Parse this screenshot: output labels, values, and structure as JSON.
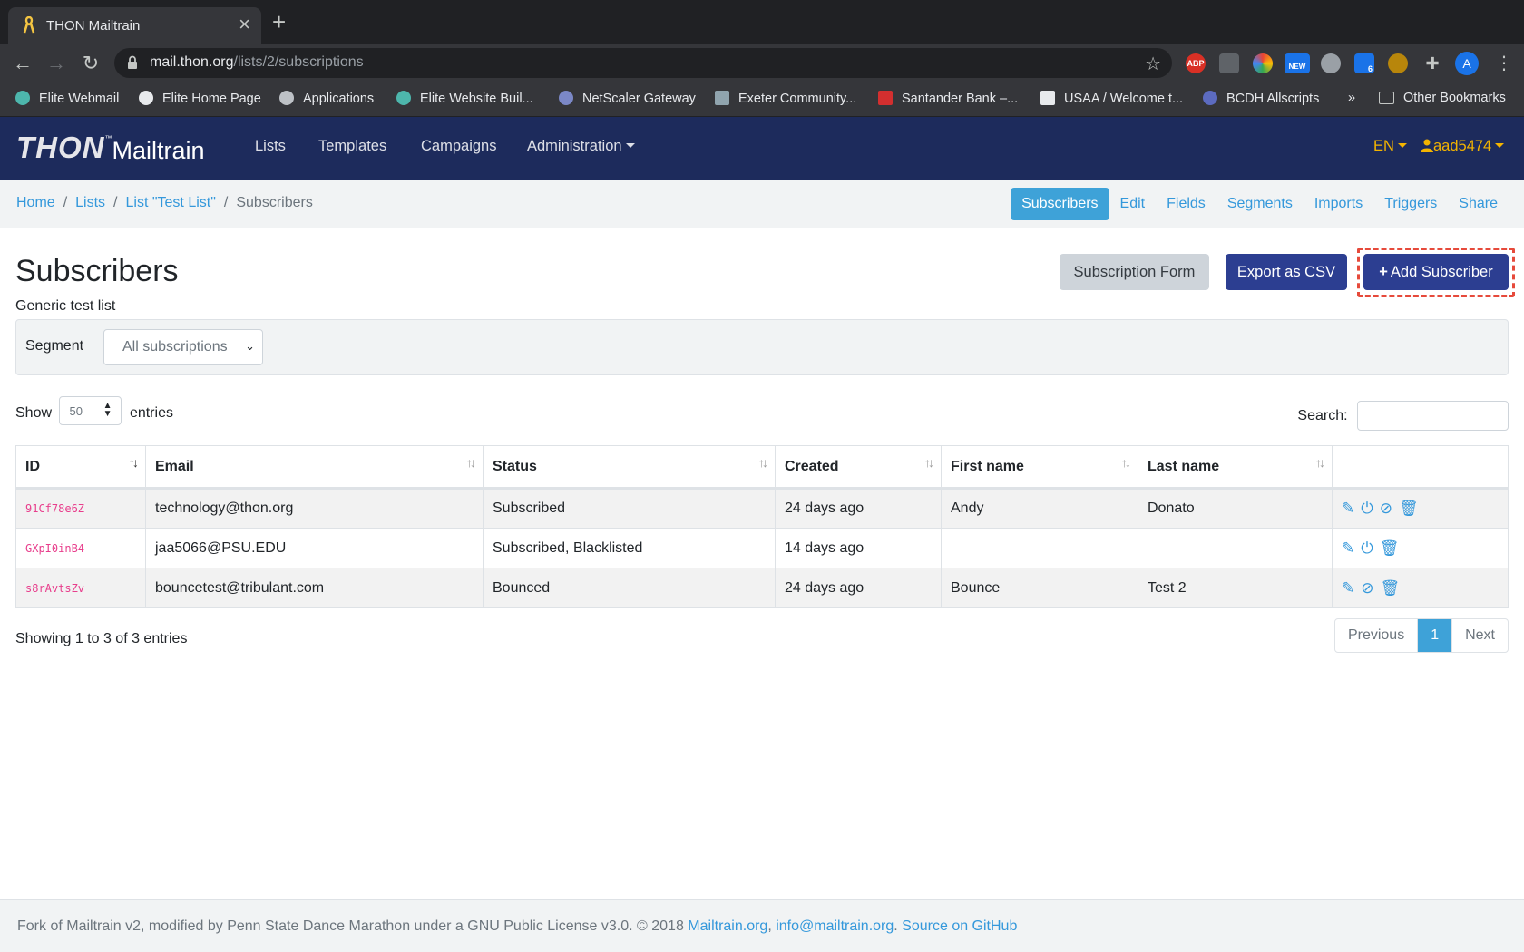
{
  "browser": {
    "tab_title": "THON Mailtrain",
    "url_host": "mail.thon.org",
    "url_path": "/lists/2/subscriptions",
    "bookmarks": [
      "Elite Webmail",
      "Elite Home Page",
      "Applications",
      "Elite Website Buil...",
      "NetScaler Gateway",
      "Exeter Community...",
      "Santander Bank –...",
      "USAA / Welcome t...",
      "BCDH Allscripts",
      "»",
      "Other Bookmarks"
    ],
    "extensions": {
      "abp": "ABP",
      "new": "NEW",
      "count": "6",
      "avatar": "A"
    }
  },
  "navbar": {
    "brand_thon": "THON",
    "brand_tm": "™",
    "brand_mail": "Mailtrain",
    "links": [
      "Lists",
      "Templates",
      "Campaigns",
      "Administration"
    ],
    "lang": "EN",
    "user": "aad5474"
  },
  "breadcrumb": [
    "Home",
    "Lists",
    "List \"Test List\"",
    "Subscribers"
  ],
  "subnav": [
    "Subscribers",
    "Edit",
    "Fields",
    "Segments",
    "Imports",
    "Triggers",
    "Share"
  ],
  "page": {
    "title": "Subscribers",
    "description": "Generic test list",
    "buttons": {
      "subscription_form": "Subscription Form",
      "export_csv": "Export as CSV",
      "add_subscriber": "Add Subscriber"
    }
  },
  "filter": {
    "label": "Segment",
    "selected": "All subscriptions"
  },
  "datatable": {
    "show_label": "Show",
    "entries_label": "entries",
    "page_length": "50",
    "search_label": "Search:",
    "search_value": "",
    "columns": [
      "ID",
      "Email",
      "Status",
      "Created",
      "First name",
      "Last name",
      ""
    ],
    "rows": [
      [
        "91Cf78e6Z",
        "technology@thon.org",
        "Subscribed",
        "24 days ago",
        "Andy",
        "Donato"
      ],
      [
        "GXpI0inB4",
        "jaa5066@PSU.EDU",
        "Subscribed, Blacklisted",
        "14 days ago",
        "",
        ""
      ],
      [
        "s8rAvtsZv",
        "bouncetest@tribulant.com",
        "Bounced",
        "24 days ago",
        "Bounce",
        "Test 2"
      ]
    ],
    "info": "Showing 1 to 3 of 3 entries",
    "pagination": {
      "previous": "Previous",
      "current": "1",
      "next": "Next"
    }
  },
  "footer": {
    "text": "Fork of Mailtrain v2, modified by Penn State Dance Marathon under a GNU Public License v3.0. © 2018 ",
    "link1": "Mailtrain.org",
    "sep1": ", ",
    "link2": "info@mailtrain.org",
    "sep2": ". ",
    "link3": "Source on GitHub"
  },
  "colors": {
    "navbar": "#1d2b5c",
    "accent": "#3498db",
    "primary_button": "#2c3e91",
    "highlight_dash": "#e64a3b",
    "user_menu": "#f4b400"
  }
}
